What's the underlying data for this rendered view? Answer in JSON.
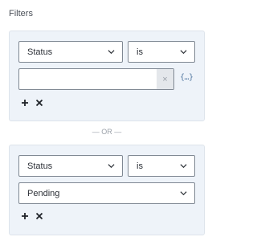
{
  "filters": {
    "title": "Filters",
    "or_separator": "— OR —",
    "groups": [
      {
        "field": "Status",
        "operator": "is",
        "value": "",
        "clear_symbol": "×",
        "variable_symbol": "{…}",
        "icons": [
          "chevron-down-icon",
          "close-icon",
          "variable-icon",
          "plus-icon",
          "close-icon"
        ]
      },
      {
        "field": "Status",
        "operator": "is",
        "value": "Pending",
        "icons": [
          "chevron-down-icon",
          "plus-icon",
          "close-icon"
        ]
      }
    ]
  }
}
